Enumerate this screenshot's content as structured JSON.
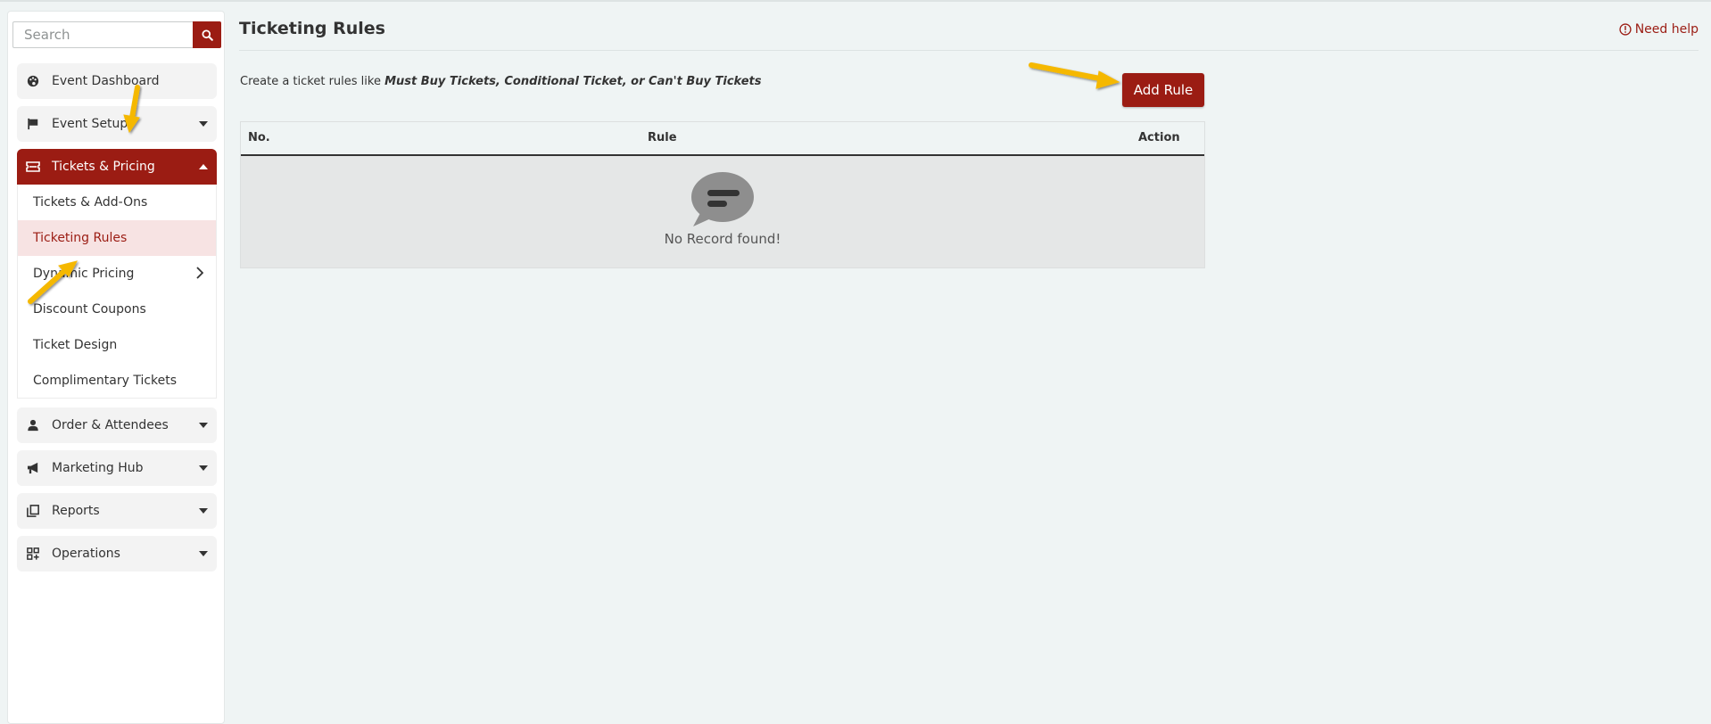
{
  "sidebar": {
    "search_placeholder": "Search",
    "items": [
      {
        "label": "Event Dashboard",
        "icon": "palette-icon"
      },
      {
        "label": "Event Setup",
        "icon": "flag-icon"
      },
      {
        "label": "Tickets & Pricing",
        "icon": "ticket-icon",
        "active": true
      },
      {
        "label": "Order & Attendees",
        "icon": "user-icon"
      },
      {
        "label": "Marketing Hub",
        "icon": "megaphone-icon"
      },
      {
        "label": "Reports",
        "icon": "reports-icon"
      },
      {
        "label": "Operations",
        "icon": "operations-icon"
      }
    ],
    "submenu": [
      {
        "label": "Tickets & Add-Ons"
      },
      {
        "label": "Ticketing Rules",
        "selected": true
      },
      {
        "label": "Dynamic Pricing"
      },
      {
        "label": "Discount Coupons"
      },
      {
        "label": "Ticket Design"
      },
      {
        "label": "Complimentary Tickets"
      }
    ]
  },
  "header": {
    "title": "Ticketing Rules",
    "help": "Need help"
  },
  "main": {
    "description_prefix": "Create a ticket rules like ",
    "description_emphasis": "Must Buy Tickets, Conditional Ticket, or Can't Buy Tickets",
    "add_button": "Add Rule",
    "table": {
      "columns": [
        "No.",
        "Rule",
        "Action"
      ],
      "empty_text": "No Record found!"
    }
  },
  "colors": {
    "brand": "#9b1c13",
    "selected_bg": "#f7e3e3",
    "page_bg": "#eff4f4",
    "annotation_arrow": "#f5b800"
  }
}
